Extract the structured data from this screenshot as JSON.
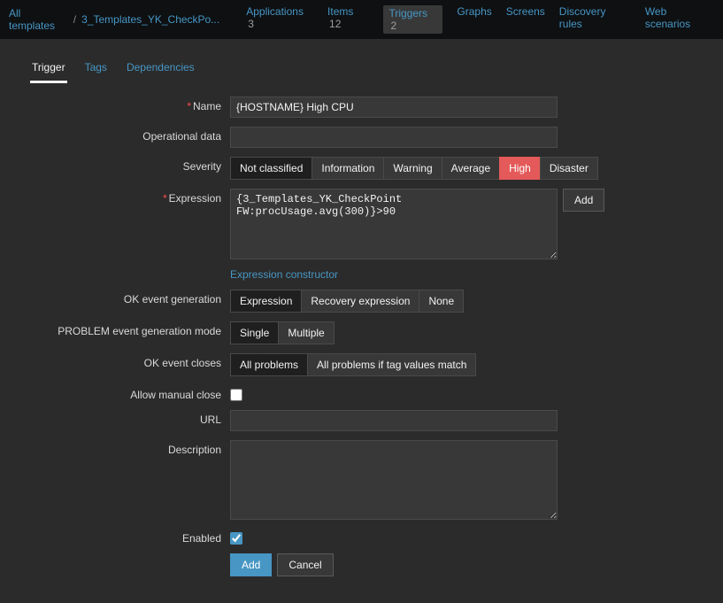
{
  "breadcrumb": {
    "back": "All templates",
    "current": "3_Templates_YK_CheckPo..."
  },
  "nav": {
    "applications": {
      "label": "Applications",
      "count": "3"
    },
    "items": {
      "label": "Items",
      "count": "12"
    },
    "triggers": {
      "label": "Triggers",
      "count": "2"
    },
    "graphs": {
      "label": "Graphs"
    },
    "screens": {
      "label": "Screens"
    },
    "discovery": {
      "label": "Discovery rules"
    },
    "web": {
      "label": "Web scenarios"
    }
  },
  "tabs": {
    "trigger": "Trigger",
    "tags": "Tags",
    "dependencies": "Dependencies"
  },
  "form": {
    "name_label": "Name",
    "name_value": "{HOSTNAME} High CPU",
    "opdata_label": "Operational data",
    "opdata_value": "",
    "severity_label": "Severity",
    "severity": {
      "not_classified": "Not classified",
      "information": "Information",
      "warning": "Warning",
      "average": "Average",
      "high": "High",
      "disaster": "Disaster"
    },
    "expression_label": "Expression",
    "expression_value": "{3_Templates_YK_CheckPoint FW:procUsage.avg(300)}>90",
    "expression_add_btn": "Add",
    "expression_constructor": "Expression constructor",
    "ok_event_gen_label": "OK event generation",
    "ok_event_gen": {
      "expression": "Expression",
      "recovery": "Recovery expression",
      "none": "None"
    },
    "problem_mode_label": "PROBLEM event generation mode",
    "problem_mode": {
      "single": "Single",
      "multiple": "Multiple"
    },
    "ok_closes_label": "OK event closes",
    "ok_closes": {
      "all": "All problems",
      "tag": "All problems if tag values match"
    },
    "allow_manual_label": "Allow manual close",
    "url_label": "URL",
    "url_value": "",
    "description_label": "Description",
    "description_value": "",
    "enabled_label": "Enabled",
    "submit_add": "Add",
    "submit_cancel": "Cancel"
  }
}
